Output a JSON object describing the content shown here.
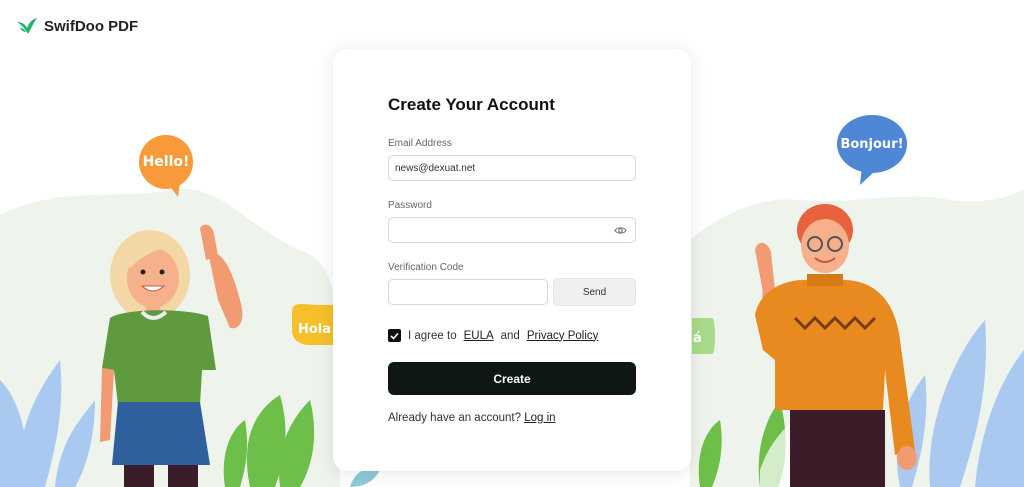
{
  "brand": {
    "name": "SwifDoo PDF",
    "accent": "#1fb66b"
  },
  "bubbles": {
    "hello": "Hello!",
    "bonjour": "Bonjour!",
    "hola": "Hola",
    "ola": "á"
  },
  "form": {
    "title": "Create Your Account",
    "email_label": "Email Address",
    "email_value": "news@dexuat.net",
    "password_label": "Password",
    "password_value": "",
    "code_label": "Verification Code",
    "code_value": "",
    "send_label": "Send",
    "agree_prefix": "I agree to",
    "eula": "EULA",
    "and": "and",
    "privacy": "Privacy Policy",
    "agree_checked": true,
    "create_label": "Create",
    "have_account": "Already have an account?",
    "login_link": "Log in"
  },
  "colors": {
    "button_dark": "#0e1714",
    "hello_bubble": "#f89a3a",
    "bonjour_bubble": "#4d87d6",
    "hola_bubble": "#f6c02a"
  },
  "icons": [
    "swifdoo-logo-icon",
    "eye-icon",
    "checkmark-icon"
  ]
}
